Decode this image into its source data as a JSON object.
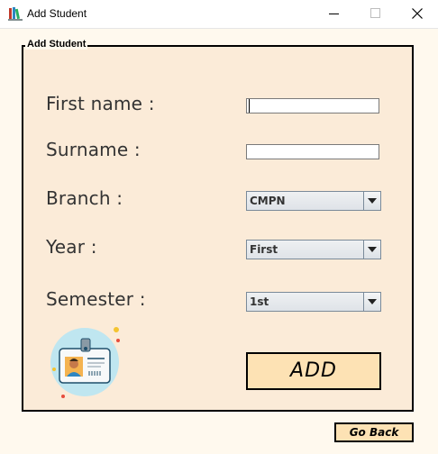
{
  "window": {
    "title": "Add Student",
    "icon": "books-icon",
    "controls": [
      "minimize-icon",
      "maximize-icon",
      "close-icon"
    ]
  },
  "panel": {
    "legend": "Add Student",
    "background": "#fbebd8"
  },
  "form": {
    "first_name_label": "First name :",
    "first_name_value": "",
    "surname_label": "Surname :",
    "surname_value": "",
    "branch_label": "Branch :",
    "branch_value": "CMPN",
    "year_label": "Year :",
    "year_value": "First",
    "semester_label": "Semester :",
    "semester_value": "1st"
  },
  "actions": {
    "add_label": "ADD",
    "back_label": "Go Back",
    "button_color": "#fde2b4"
  },
  "illustration": {
    "icon": "id-card-icon"
  }
}
